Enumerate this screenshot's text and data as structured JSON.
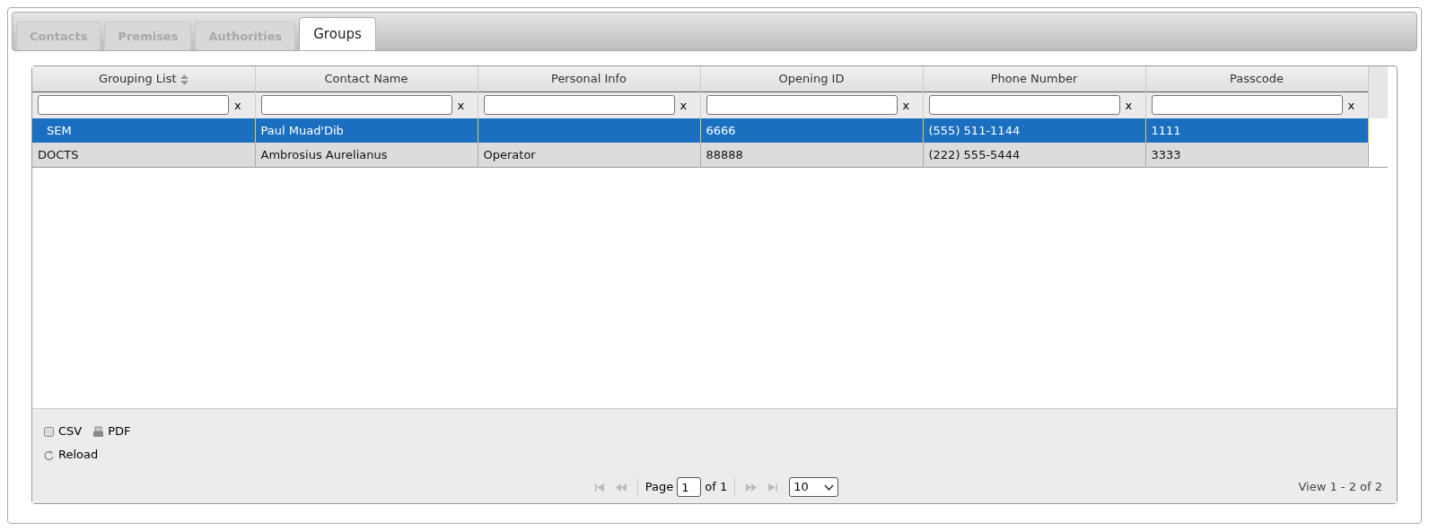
{
  "tabs": [
    {
      "label": "Contacts",
      "selected": false
    },
    {
      "label": "Premises",
      "selected": false
    },
    {
      "label": "Authorities",
      "selected": false
    },
    {
      "label": "Groups",
      "selected": true
    }
  ],
  "table": {
    "columns": [
      {
        "label": "Grouping List",
        "sortable": true,
        "filter_clear": "x"
      },
      {
        "label": "Contact Name",
        "sortable": false,
        "filter_clear": "x"
      },
      {
        "label": "Personal Info",
        "sortable": false,
        "filter_clear": "x"
      },
      {
        "label": "Opening ID",
        "sortable": false,
        "filter_clear": "x"
      },
      {
        "label": "Phone Number",
        "sortable": false,
        "filter_clear": "x"
      },
      {
        "label": "Passcode",
        "sortable": false,
        "filter_clear": "x"
      }
    ],
    "rows": [
      {
        "selected": true,
        "cells": [
          "SEM",
          "Paul Muad'Dib",
          "",
          "6666",
          "(555) 511-1144",
          "1111"
        ]
      },
      {
        "selected": false,
        "cells": [
          "DOCTS",
          "Ambrosius Aurelianus",
          "Operator",
          "88888",
          "(222) 555-5444",
          "3333"
        ]
      }
    ]
  },
  "footer": {
    "export_buttons": [
      "CSV",
      "PDF"
    ],
    "reload": "Reload",
    "pager": {
      "page_label": "Page",
      "page": "1",
      "of_label": "of 1",
      "page_size": "10"
    },
    "view_info": "View 1 - 2 of 2"
  }
}
